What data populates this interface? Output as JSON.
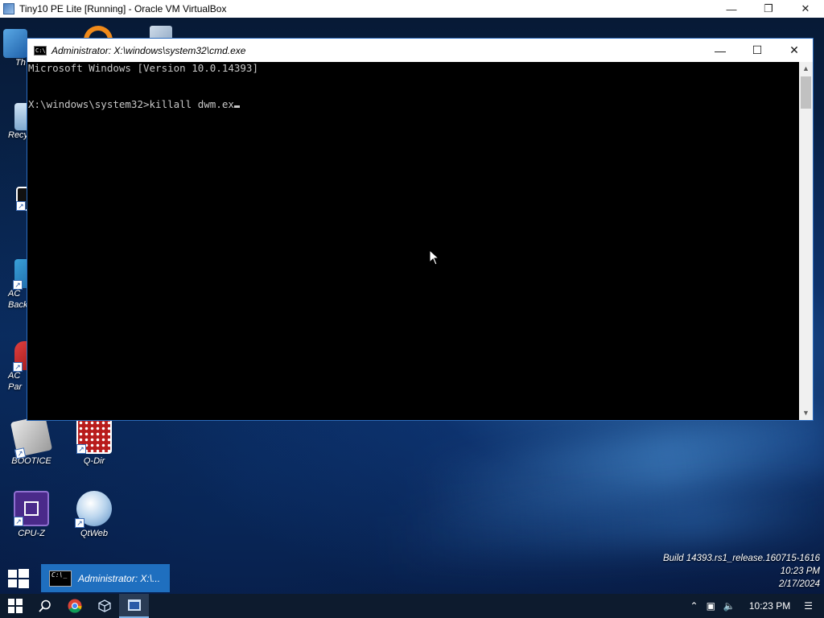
{
  "host": {
    "title": "Tiny10 PE Lite [Running] - Oracle VM VirtualBox"
  },
  "desktop_icons": [
    {
      "label": "Th"
    },
    {
      "label": "Recy"
    },
    {
      "label": ""
    },
    {
      "label": "AC Back"
    },
    {
      "label": "AC Par"
    },
    {
      "label": "BOOTICE"
    },
    {
      "label": "Q-Dir"
    },
    {
      "label": "CPU-Z"
    },
    {
      "label": "QtWeb"
    }
  ],
  "cmd": {
    "title": "Administrator: X:\\windows\\system32\\cmd.exe",
    "line1": "Microsoft Windows [Version 10.0.14393]",
    "line2": "X:\\windows\\system32>killall dwm.ex"
  },
  "build": {
    "line1": "Build 14393.rs1_release.160715-1616",
    "line2": "10:23 PM",
    "line3": "2/17/2024"
  },
  "task_button": {
    "label": "Administrator: X:\\..."
  },
  "taskbar": {
    "clock": "10:23 PM"
  },
  "colors": {
    "accent": "#1f6fbf",
    "console_bg": "#000000",
    "console_fg": "#c8c8c8"
  }
}
